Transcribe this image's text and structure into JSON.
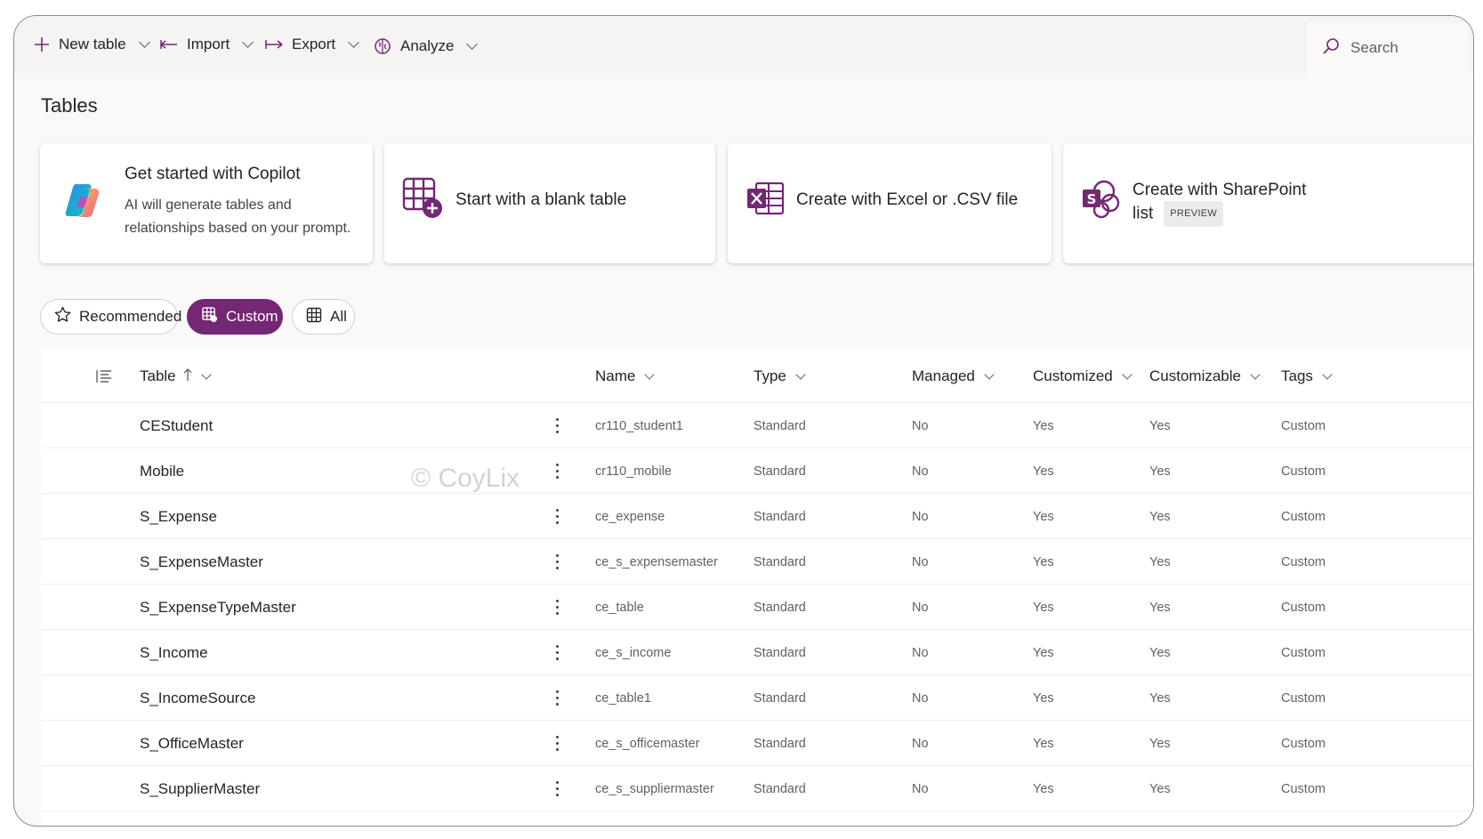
{
  "toolbar": {
    "new_table": "New table",
    "import": "Import",
    "export": "Export",
    "analyze": "Analyze",
    "search_placeholder": "Search"
  },
  "page_title": "Tables",
  "cards": {
    "copilot": {
      "title": "Get started with Copilot",
      "desc1": "AI will generate tables and",
      "desc2": "relationships based on your prompt."
    },
    "blank": {
      "title": "Start with a blank table"
    },
    "excel": {
      "title": "Create with Excel or .CSV file"
    },
    "sharepoint": {
      "title1": "Create with SharePoint",
      "title2": "list",
      "badge": "PREVIEW"
    }
  },
  "filters": {
    "recommended": "Recommended",
    "custom": "Custom",
    "all": "All"
  },
  "columns": {
    "table": "Table",
    "name": "Name",
    "type": "Type",
    "managed": "Managed",
    "customized": "Customized",
    "customizable": "Customizable",
    "tags": "Tags"
  },
  "rows": [
    {
      "table": "CEStudent",
      "name": "cr110_student1",
      "type": "Standard",
      "managed": "No",
      "customized": "Yes",
      "customizable": "Yes",
      "tags": "Custom"
    },
    {
      "table": "Mobile",
      "name": "cr110_mobile",
      "type": "Standard",
      "managed": "No",
      "customized": "Yes",
      "customizable": "Yes",
      "tags": "Custom"
    },
    {
      "table": "S_Expense",
      "name": "ce_expense",
      "type": "Standard",
      "managed": "No",
      "customized": "Yes",
      "customizable": "Yes",
      "tags": "Custom"
    },
    {
      "table": "S_ExpenseMaster",
      "name": "ce_s_expensemaster",
      "type": "Standard",
      "managed": "No",
      "customized": "Yes",
      "customizable": "Yes",
      "tags": "Custom"
    },
    {
      "table": "S_ExpenseTypeMaster",
      "name": "ce_table",
      "type": "Standard",
      "managed": "No",
      "customized": "Yes",
      "customizable": "Yes",
      "tags": "Custom"
    },
    {
      "table": "S_Income",
      "name": "ce_s_income",
      "type": "Standard",
      "managed": "No",
      "customized": "Yes",
      "customizable": "Yes",
      "tags": "Custom"
    },
    {
      "table": "S_IncomeSource",
      "name": "ce_table1",
      "type": "Standard",
      "managed": "No",
      "customized": "Yes",
      "customizable": "Yes",
      "tags": "Custom"
    },
    {
      "table": "S_OfficeMaster",
      "name": "ce_s_officemaster",
      "type": "Standard",
      "managed": "No",
      "customized": "Yes",
      "customizable": "Yes",
      "tags": "Custom"
    },
    {
      "table": "S_SupplierMaster",
      "name": "ce_s_suppliermaster",
      "type": "Standard",
      "managed": "No",
      "customized": "Yes",
      "customizable": "Yes",
      "tags": "Custom"
    }
  ],
  "watermark": "© CoyLix",
  "colors": {
    "accent": "#742774",
    "icon_purple": "#6b2d9c"
  },
  "icons": {
    "new_table": "plus-icon",
    "import": "import-arrow-icon",
    "export": "export-arrow-icon",
    "analyze": "analyze-brain-icon",
    "search": "search-icon"
  }
}
